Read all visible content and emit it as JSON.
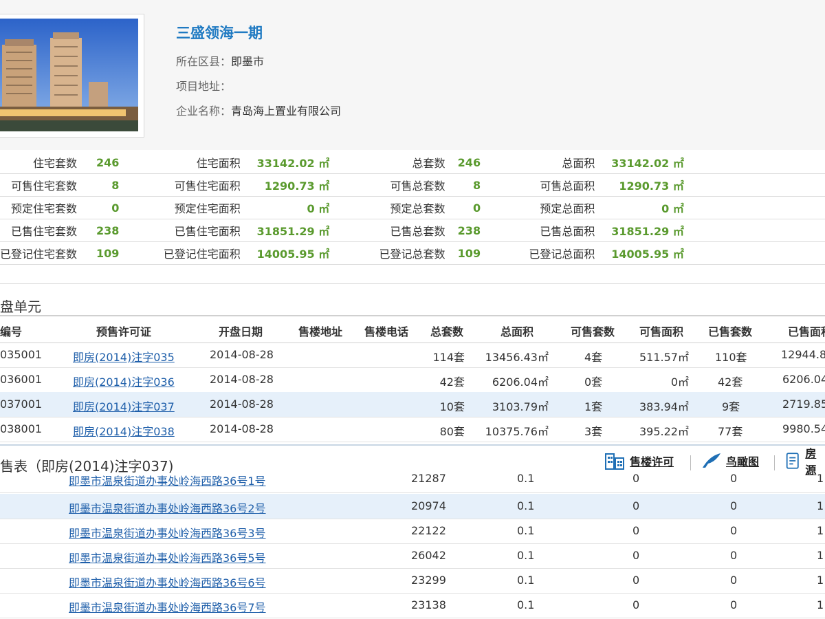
{
  "project": {
    "title": "三盛领海一期",
    "district_label": "所在区县：",
    "district_value": "即墨市",
    "address_label": "项目地址：",
    "address_value": "",
    "company_label": "企业名称：",
    "company_value": "青岛海上置业有限公司"
  },
  "stats": [
    {
      "l1": "住宅套数",
      "v1": "246",
      "l2": "住宅面积",
      "v2": "33142.02 ㎡",
      "l3": "总套数",
      "v3": "246",
      "l4": "总面积",
      "v4": "33142.02 ㎡"
    },
    {
      "l1": "可售住宅套数",
      "v1": "8",
      "l2": "可售住宅面积",
      "v2": "1290.73 ㎡",
      "l3": "可售总套数",
      "v3": "8",
      "l4": "可售总面积",
      "v4": "1290.73 ㎡"
    },
    {
      "l1": "预定住宅套数",
      "v1": "0",
      "l2": "预定住宅面积",
      "v2": "0 ㎡",
      "l3": "预定总套数",
      "v3": "0",
      "l4": "预定总面积",
      "v4": "0 ㎡"
    },
    {
      "l1": "已售住宅套数",
      "v1": "238",
      "l2": "已售住宅面积",
      "v2": "31851.29 ㎡",
      "l3": "已售总套数",
      "v3": "238",
      "l4": "已售总面积",
      "v4": "31851.29 ㎡"
    },
    {
      "l1": "已登记住宅套数",
      "v1": "109",
      "l2": "已登记住宅面积",
      "v2": "14005.95 ㎡",
      "l3": "已登记总套数",
      "v3": "109",
      "l4": "已登记总面积",
      "v4": "14005.95 ㎡"
    }
  ],
  "sales_section_title": "盘单元",
  "sales_headers": [
    "编号",
    "预售许可证",
    "开盘日期",
    "售楼地址",
    "售楼电话",
    "总套数",
    "总面积",
    "可售套数",
    "可售面积",
    "已售套数",
    "已售面积"
  ],
  "sales_rows": [
    {
      "id": "035001",
      "permit": "即房(2014)注字035",
      "date": "2014-08-28",
      "total": "114套",
      "area": "13456.43㎡",
      "avail": "4套",
      "avail_area": "511.57㎡",
      "sold": "110套",
      "sold_area": "12944.8"
    },
    {
      "id": "036001",
      "permit": "即房(2014)注字036",
      "date": "2014-08-28",
      "total": "42套",
      "area": "6206.04㎡",
      "avail": "0套",
      "avail_area": "0㎡",
      "sold": "42套",
      "sold_area": "6206.04"
    },
    {
      "id": "037001",
      "permit": "即房(2014)注字037",
      "date": "2014-08-28",
      "total": "10套",
      "area": "3103.79㎡",
      "avail": "1套",
      "avail_area": "383.94㎡",
      "sold": "9套",
      "sold_area": "2719.85"
    },
    {
      "id": "038001",
      "permit": "即房(2014)注字038",
      "date": "2014-08-28",
      "total": "80套",
      "area": "10375.76㎡",
      "avail": "3套",
      "avail_area": "395.22㎡",
      "sold": "77套",
      "sold_area": "9980.54"
    }
  ],
  "building_section_title": "售表（即房(2014)注字037)",
  "tools": {
    "permit": "售楼许可",
    "aerial": "鸟瞰图",
    "house": "房源"
  },
  "building_rows": [
    {
      "addr": "即墨市温泉街道办事处岭海西路36号1号",
      "code": "21287",
      "a": "0.1",
      "b": "0",
      "c": "0",
      "d": "1"
    },
    {
      "addr": "即墨市温泉街道办事处岭海西路36号2号",
      "code": "20974",
      "a": "0.1",
      "b": "0",
      "c": "0",
      "d": "1"
    },
    {
      "addr": "即墨市温泉街道办事处岭海西路36号3号",
      "code": "22122",
      "a": "0.1",
      "b": "0",
      "c": "0",
      "d": "1"
    },
    {
      "addr": "即墨市温泉街道办事处岭海西路36号5号",
      "code": "26042",
      "a": "0.1",
      "b": "0",
      "c": "0",
      "d": "1"
    },
    {
      "addr": "即墨市温泉街道办事处岭海西路36号6号",
      "code": "23299",
      "a": "0.1",
      "b": "0",
      "c": "0",
      "d": "1"
    },
    {
      "addr": "即墨市温泉街道办事处岭海西路36号7号",
      "code": "23138",
      "a": "0.1",
      "b": "0",
      "c": "0",
      "d": "1"
    }
  ],
  "colors": {
    "link": "#1f5faa",
    "title": "#1f7ac2",
    "value": "#5a9a2e",
    "highlight": "#e6f0fa"
  }
}
